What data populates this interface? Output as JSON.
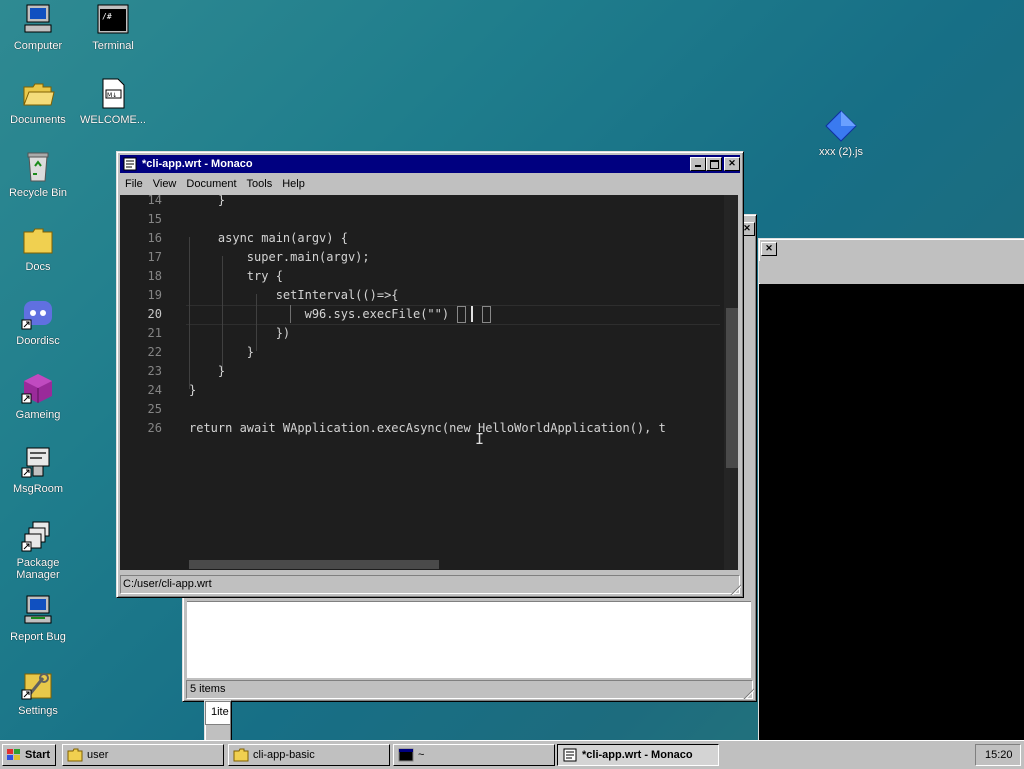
{
  "desktop": {
    "icons": [
      {
        "label": "Computer"
      },
      {
        "label": "Terminal"
      },
      {
        "label": "Documents"
      },
      {
        "label": "WELCOME..."
      },
      {
        "label": "Recycle Bin"
      },
      {
        "label": "Docs"
      },
      {
        "label": "Doordisc"
      },
      {
        "label": "Gameing"
      },
      {
        "label": "MsgRoom"
      },
      {
        "label": "Package Manager"
      },
      {
        "label": "Report Bug"
      },
      {
        "label": "Settings"
      },
      {
        "label": "xxx (2).js"
      }
    ]
  },
  "editor_window": {
    "title": "*cli-app.wrt - Monaco",
    "menu": [
      "File",
      "View",
      "Document",
      "Tools",
      "Help"
    ],
    "lines": [
      {
        "num": "14",
        "text": "    }"
      },
      {
        "num": "15",
        "text": ""
      },
      {
        "num": "16",
        "text": "    async main(argv) {"
      },
      {
        "num": "17",
        "text": "        super.main(argv);"
      },
      {
        "num": "18",
        "text": "        try {"
      },
      {
        "num": "19",
        "text": "            setInterval(()=>{"
      },
      {
        "num": "20",
        "text": "                w96.sys.execFile(\"\")"
      },
      {
        "num": "21",
        "text": "            })"
      },
      {
        "num": "22",
        "text": "        }"
      },
      {
        "num": "23",
        "text": "    }"
      },
      {
        "num": "24",
        "text": "}"
      },
      {
        "num": "25",
        "text": ""
      },
      {
        "num": "26",
        "text": "return await WApplication.execAsync(new HelloWorldApplication(), t"
      }
    ],
    "status_path": "C:/user/cli-app.wrt"
  },
  "explorer_window": {
    "status": "5 items"
  },
  "peek_text": "1ite",
  "taskbar": {
    "start_label": "Start",
    "tasks": [
      {
        "label": "user"
      },
      {
        "label": "cli-app-basic"
      },
      {
        "label": "~"
      },
      {
        "label": "*cli-app.wrt - Monaco"
      }
    ],
    "clock": "15:20"
  }
}
